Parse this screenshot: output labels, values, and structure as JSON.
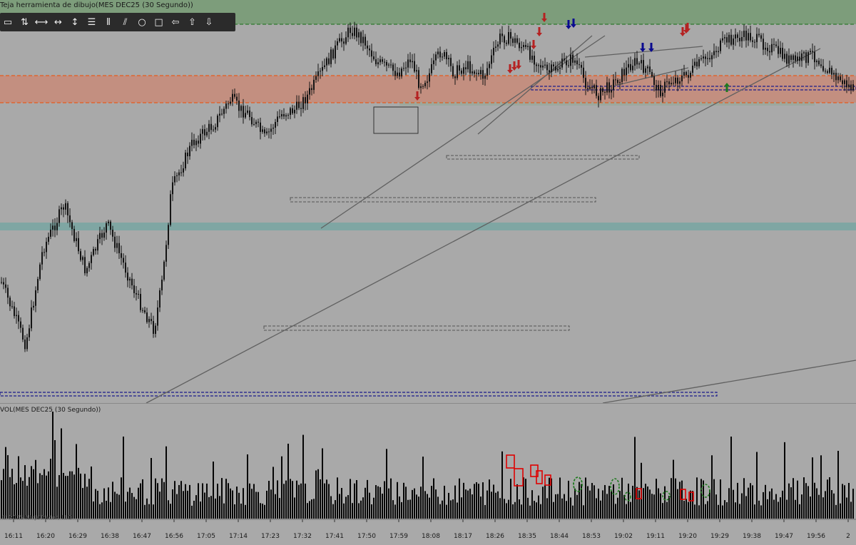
{
  "window": {
    "chart_title": "Teja herramienta de dibujo(MES DEC25 (30 Segundo))",
    "volume_title": "VOL(MES DEC25 (30 Segundo))",
    "copyright": "© 2025 NinjaTrader, LLC"
  },
  "toolbar": {
    "tools": [
      {
        "name": "ruler-icon",
        "glyph": "▭"
      },
      {
        "name": "risk-reward-icon",
        "glyph": "⇅"
      },
      {
        "name": "line-icon",
        "glyph": "⟷"
      },
      {
        "name": "ray-icon",
        "glyph": "↔"
      },
      {
        "name": "vertical-line-icon",
        "glyph": "↕"
      },
      {
        "name": "horizontal-lines-icon",
        "glyph": "☰"
      },
      {
        "name": "vertical-lines-icon",
        "glyph": "⦀"
      },
      {
        "name": "channel-icon",
        "glyph": "⫽"
      },
      {
        "name": "ellipse-icon",
        "glyph": "○"
      },
      {
        "name": "rectangle-icon",
        "glyph": "□"
      },
      {
        "name": "arrow-line-icon",
        "glyph": "⇦"
      },
      {
        "name": "arrow-up-icon",
        "glyph": "⇧"
      },
      {
        "name": "arrow-down-icon",
        "glyph": "⇩"
      }
    ]
  },
  "colors": {
    "background": "#a9a9a9",
    "candle": "#141414",
    "green_zone": "#7d9d7b",
    "red_zone": "#c38f80",
    "teal_band": "#7fa6a3",
    "orange_dash": "#e65c1e",
    "green_dash": "#2e7a2e",
    "navy_dash": "#1c1c8c",
    "down_arrow": "#b52222",
    "blue_arrow": "#0a0a8f",
    "up_arrow": "#1f7a1f",
    "volume_bar": "#050505"
  },
  "chart_data": {
    "type": "candlestick",
    "x_ticks": [
      "16:11",
      "16:20",
      "16:29",
      "16:38",
      "16:47",
      "16:56",
      "17:05",
      "17:14",
      "17:23",
      "17:32",
      "17:41",
      "17:50",
      "17:59",
      "18:08",
      "18:17",
      "18:26",
      "18:35",
      "18:44",
      "18:53",
      "19:02",
      "19:11",
      "19:20",
      "19:29",
      "19:38",
      "19:47",
      "19:56",
      "2"
    ],
    "price_keypoints": [
      [
        0,
        0.7
      ],
      [
        0.06,
        0.88
      ],
      [
        0.1,
        0.62
      ],
      [
        0.15,
        0.5
      ],
      [
        0.2,
        0.68
      ],
      [
        0.25,
        0.55
      ],
      [
        0.32,
        0.75
      ],
      [
        0.36,
        0.84
      ],
      [
        0.38,
        0.7
      ],
      [
        0.4,
        0.46
      ],
      [
        0.43,
        0.38
      ],
      [
        0.45,
        0.33
      ],
      [
        0.5,
        0.28
      ],
      [
        0.54,
        0.21
      ],
      [
        0.56,
        0.24
      ],
      [
        0.58,
        0.25
      ],
      [
        0.62,
        0.32
      ],
      [
        0.64,
        0.28
      ],
      [
        0.66,
        0.25
      ],
      [
        0.69,
        0.24
      ],
      [
        0.72,
        0.2
      ],
      [
        0.75,
        0.14
      ],
      [
        0.78,
        0.08
      ],
      [
        0.82,
        0.02
      ],
      [
        0.85,
        0.05
      ],
      [
        0.88,
        0.11
      ],
      [
        0.91,
        0.13
      ],
      [
        0.93,
        0.14
      ],
      [
        0.96,
        0.1
      ],
      [
        0.98,
        0.17
      ],
      [
        1.0,
        0.15
      ],
      [
        1.03,
        0.08
      ],
      [
        1.06,
        0.14
      ],
      [
        1.09,
        0.12
      ],
      [
        1.13,
        0.15
      ],
      [
        1.17,
        0.04
      ],
      [
        1.2,
        0.05
      ],
      [
        1.24,
        0.09
      ],
      [
        1.28,
        0.14
      ],
      [
        1.31,
        0.12
      ],
      [
        1.34,
        0.1
      ],
      [
        1.37,
        0.17
      ],
      [
        1.4,
        0.2
      ],
      [
        1.44,
        0.16
      ],
      [
        1.48,
        0.11
      ],
      [
        1.51,
        0.13
      ],
      [
        1.54,
        0.19
      ],
      [
        1.57,
        0.16
      ],
      [
        1.6,
        0.15
      ],
      [
        1.65,
        0.1
      ],
      [
        1.7,
        0.05
      ],
      [
        1.75,
        0.04
      ],
      [
        1.8,
        0.07
      ],
      [
        1.85,
        0.11
      ],
      [
        1.9,
        0.09
      ],
      [
        1.95,
        0.15
      ],
      [
        2.0,
        0.19
      ]
    ],
    "marker_counts": {
      "red_down_arrows": 10,
      "blue_down_arrows": 4,
      "green_up_arrows": 1,
      "red_volume_boxes": 8,
      "green_volume_ellipses": 6
    }
  }
}
